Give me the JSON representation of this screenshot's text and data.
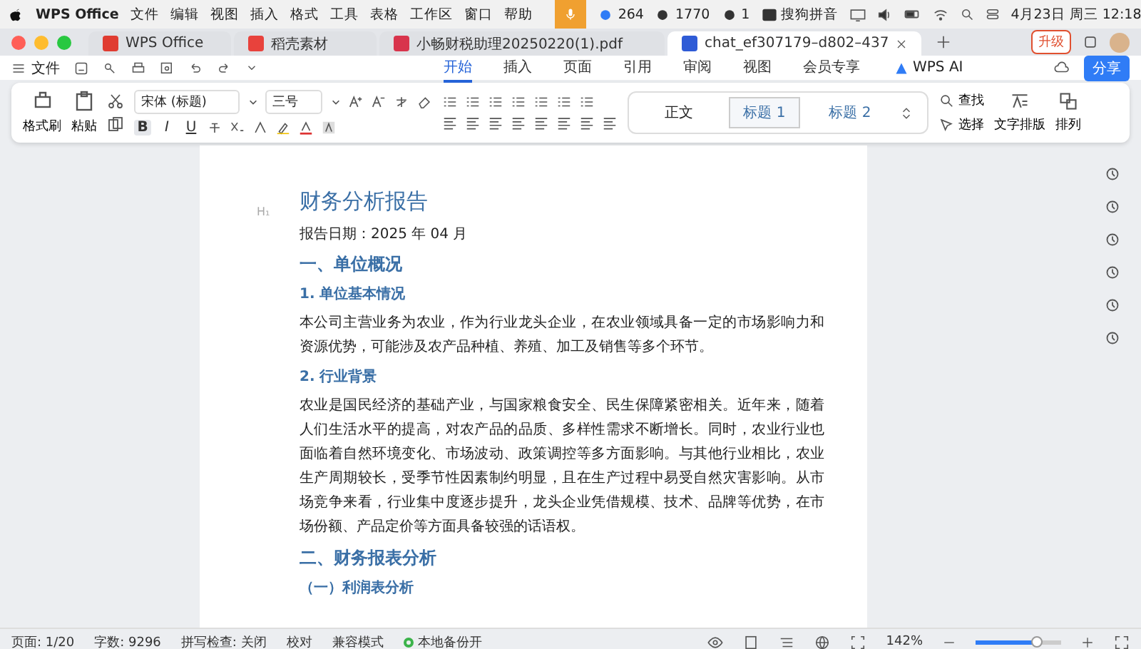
{
  "menu_bar": {
    "app": "WPS Office",
    "items": [
      "文件",
      "编辑",
      "视图",
      "插入",
      "格式",
      "工具",
      "表格",
      "工作区",
      "窗口",
      "帮助"
    ],
    "status_items": [
      {
        "kind": "count",
        "text": "264"
      },
      {
        "kind": "count",
        "text": "1770"
      },
      {
        "kind": "count",
        "text": "1"
      },
      {
        "kind": "ime",
        "text": "搜狗拼音"
      }
    ],
    "clock": "4月23日 周三 12:18"
  },
  "tabs": [
    {
      "label": "WPS Office",
      "kind": "home",
      "selected": false
    },
    {
      "label": "稻壳素材",
      "kind": "docer",
      "selected": false
    },
    {
      "label": "小畅财税助理20250220(1).pdf",
      "kind": "pdf",
      "selected": false
    },
    {
      "label": "chat_ef307179–d802–437",
      "kind": "doc",
      "selected": true
    }
  ],
  "upgrade_button": "升级",
  "menu": {
    "file": "文件",
    "tabs": [
      {
        "label": "开始",
        "selected": true
      },
      {
        "label": "插入",
        "selected": false
      },
      {
        "label": "页面",
        "selected": false
      },
      {
        "label": "引用",
        "selected": false
      },
      {
        "label": "审阅",
        "selected": false
      },
      {
        "label": "视图",
        "selected": false
      },
      {
        "label": "会员专享",
        "selected": false
      }
    ],
    "ai": "WPS AI",
    "share": "分享"
  },
  "ribbon": {
    "format_painter": "格式刷",
    "paste": "粘贴",
    "font": "宋体 (标题)",
    "size": "三号",
    "format_glyphs": [
      "B",
      "I",
      "U"
    ],
    "styles": [
      {
        "label": "正文",
        "selected": false
      },
      {
        "label": "标题 1",
        "selected": true
      },
      {
        "label": "标题 2",
        "selected": false
      }
    ],
    "find": "查找",
    "select": "选择",
    "text_layout": "文字排版",
    "arrange": "排列"
  },
  "document": {
    "heading_marker": "H₁",
    "blocks": [
      {
        "kind": "title",
        "text": "财务分析报告"
      },
      {
        "kind": "date",
        "text": "报告日期：2025 年 04 月"
      },
      {
        "kind": "h1",
        "text": "一、单位概况"
      },
      {
        "kind": "h2",
        "text": "1. 单位基本情况"
      },
      {
        "kind": "para",
        "text": "本公司主营业务为农业，作为行业龙头企业，在农业领域具备一定的市场影响力和资源优势，可能涉及农产品种植、养殖、加工及销售等多个环节。"
      },
      {
        "kind": "h2",
        "text": "2. 行业背景"
      },
      {
        "kind": "para",
        "text": "农业是国民经济的基础产业，与国家粮食安全、民生保障紧密相关。近年来，随着人们生活水平的提高，对农产品的品质、多样性需求不断增长。同时，农业行业也面临着自然环境变化、市场波动、政策调控等多方面影响。与其他行业相比，农业生产周期较长，受季节性因素制约明显，且在生产过程中易受自然灾害影响。从市场竞争来看，行业集中度逐步提升，龙头企业凭借规模、技术、品牌等优势，在市场份额、产品定价等方面具备较强的话语权。"
      },
      {
        "kind": "h1",
        "text": "二、财务报表分析"
      },
      {
        "kind": "h3",
        "text": "（一）利润表分析"
      }
    ]
  },
  "status_bar": {
    "page": "页面: 1/20",
    "words": "字数: 9296",
    "spell": "拼写检查: 关闭",
    "proof": "校对",
    "compat": "兼容模式",
    "backup": {
      "text": "本地备份开",
      "on": true
    },
    "zoom": "142%",
    "zoom_slider": {
      "level": 0.72
    }
  }
}
